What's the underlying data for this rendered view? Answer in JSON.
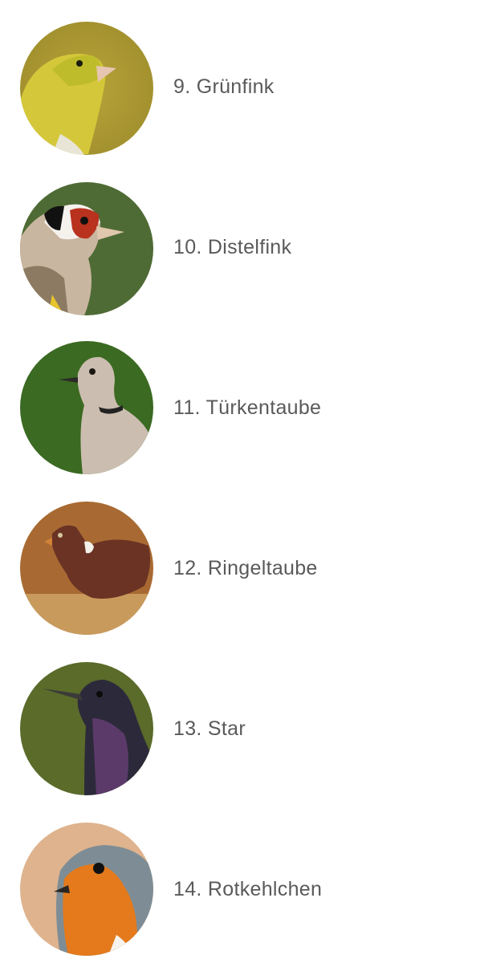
{
  "birds": [
    {
      "name": "9. Grünfink",
      "icon": "greenfinch-photo"
    },
    {
      "name": "10. Distelfink",
      "icon": "goldfinch-photo"
    },
    {
      "name": "11. Türkentaube",
      "icon": "collared-dove-photo"
    },
    {
      "name": "12. Ringeltaube",
      "icon": "wood-pigeon-photo"
    },
    {
      "name": "13. Star",
      "icon": "starling-photo"
    },
    {
      "name": "14. Rotkehlchen",
      "icon": "robin-photo"
    }
  ],
  "colors": {
    "text": "#5a5a5a",
    "background": "#ffffff"
  }
}
